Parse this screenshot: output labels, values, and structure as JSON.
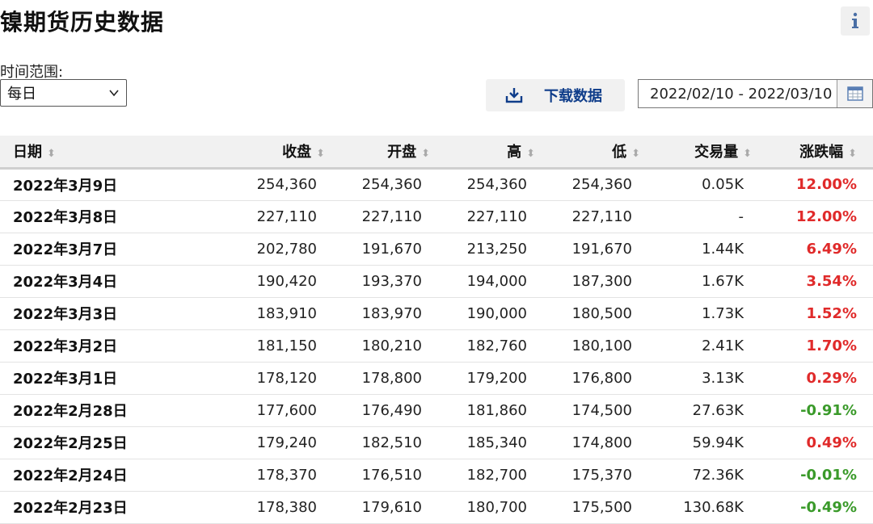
{
  "page": {
    "title": "镍期货历史数据"
  },
  "controls": {
    "range_label": "时间范围:",
    "interval_value": "每日",
    "download_label": "下载数据",
    "date_range": "2022/02/10 - 2022/03/10"
  },
  "icons": {
    "info": "info-icon",
    "chevron": "chevron-down-icon",
    "download": "download-icon",
    "calendar": "calendar-icon"
  },
  "colors": {
    "up": "#e02a2a",
    "down": "#3a9a2a",
    "link": "#0f3d8a"
  },
  "table": {
    "headers": {
      "date": "日期",
      "close": "收盘",
      "open": "开盘",
      "high": "高",
      "low": "低",
      "volume": "交易量",
      "change": "涨跌幅"
    },
    "rows": [
      {
        "date": "2022年3月9日",
        "close": "254,360",
        "open": "254,360",
        "high": "254,360",
        "low": "254,360",
        "volume": "0.05K",
        "change": "12.00%",
        "trend": "up"
      },
      {
        "date": "2022年3月8日",
        "close": "227,110",
        "open": "227,110",
        "high": "227,110",
        "low": "227,110",
        "volume": "-",
        "change": "12.00%",
        "trend": "up"
      },
      {
        "date": "2022年3月7日",
        "close": "202,780",
        "open": "191,670",
        "high": "213,250",
        "low": "191,670",
        "volume": "1.44K",
        "change": "6.49%",
        "trend": "up"
      },
      {
        "date": "2022年3月4日",
        "close": "190,420",
        "open": "193,370",
        "high": "194,000",
        "low": "187,300",
        "volume": "1.67K",
        "change": "3.54%",
        "trend": "up"
      },
      {
        "date": "2022年3月3日",
        "close": "183,910",
        "open": "183,970",
        "high": "190,000",
        "low": "180,500",
        "volume": "1.73K",
        "change": "1.52%",
        "trend": "up"
      },
      {
        "date": "2022年3月2日",
        "close": "181,150",
        "open": "180,210",
        "high": "182,760",
        "low": "180,100",
        "volume": "2.41K",
        "change": "1.70%",
        "trend": "up"
      },
      {
        "date": "2022年3月1日",
        "close": "178,120",
        "open": "178,800",
        "high": "179,200",
        "low": "176,800",
        "volume": "3.13K",
        "change": "0.29%",
        "trend": "up"
      },
      {
        "date": "2022年2月28日",
        "close": "177,600",
        "open": "176,490",
        "high": "181,860",
        "low": "174,500",
        "volume": "27.63K",
        "change": "-0.91%",
        "trend": "down"
      },
      {
        "date": "2022年2月25日",
        "close": "179,240",
        "open": "182,510",
        "high": "185,340",
        "low": "174,800",
        "volume": "59.94K",
        "change": "0.49%",
        "trend": "up"
      },
      {
        "date": "2022年2月24日",
        "close": "178,370",
        "open": "176,510",
        "high": "182,700",
        "low": "175,370",
        "volume": "72.36K",
        "change": "-0.01%",
        "trend": "down"
      },
      {
        "date": "2022年2月23日",
        "close": "178,380",
        "open": "179,610",
        "high": "180,700",
        "low": "175,500",
        "volume": "130.68K",
        "change": "-0.49%",
        "trend": "down"
      }
    ]
  }
}
